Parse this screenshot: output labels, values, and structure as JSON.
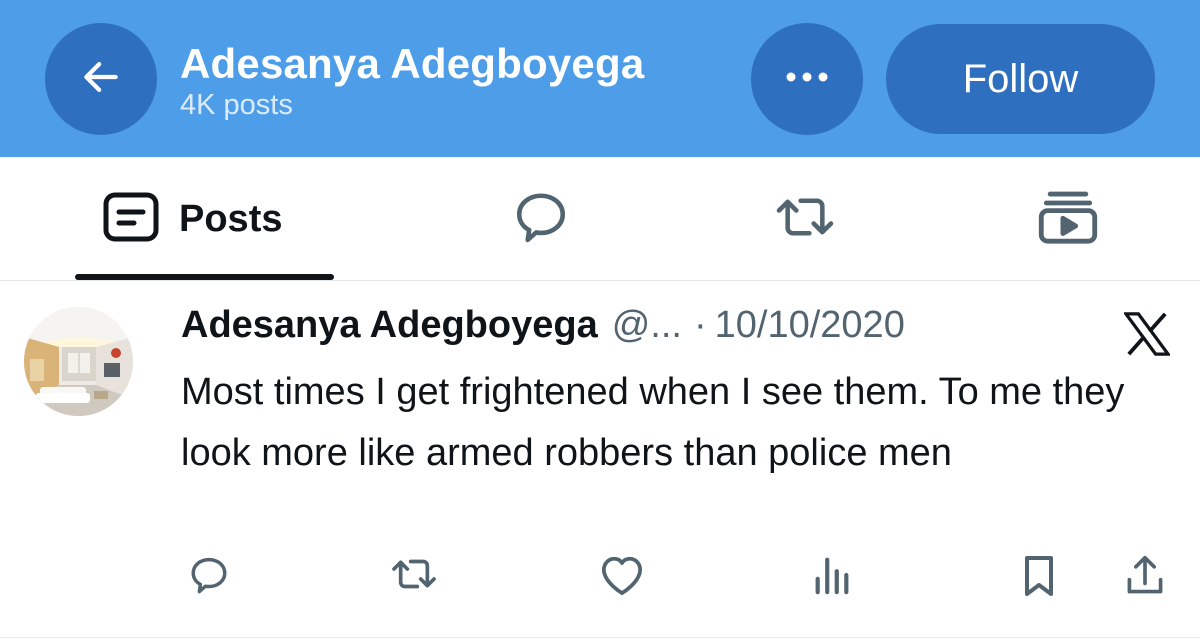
{
  "header": {
    "title": "Adesanya Adegboyega",
    "post_count": "4K posts",
    "follow_label": "Follow",
    "background_color": "#4d9de8",
    "button_color": "#2f6fc0"
  },
  "icons": {
    "back": "arrow-left-icon",
    "more": "more-horizontal-icon"
  },
  "tabs": [
    {
      "label": "Posts",
      "icon": "posts-icon",
      "active": true
    },
    {
      "label": "",
      "icon": "reply-bubble-icon",
      "active": false
    },
    {
      "label": "",
      "icon": "repost-icon",
      "active": false
    },
    {
      "label": "",
      "icon": "media-play-icon",
      "active": false
    }
  ],
  "tweet": {
    "author_name": "Adesanya Adegboyega",
    "handle": "@...",
    "separator": "·",
    "date": "10/10/2020",
    "text": "Most times I get frightened when I see them. To me they look more like armed robbers than police men",
    "source_icon": "x-logo-icon",
    "actions": [
      "reply-icon",
      "repost-icon",
      "like-icon",
      "views-icon",
      "bookmark-icon",
      "share-icon"
    ]
  }
}
